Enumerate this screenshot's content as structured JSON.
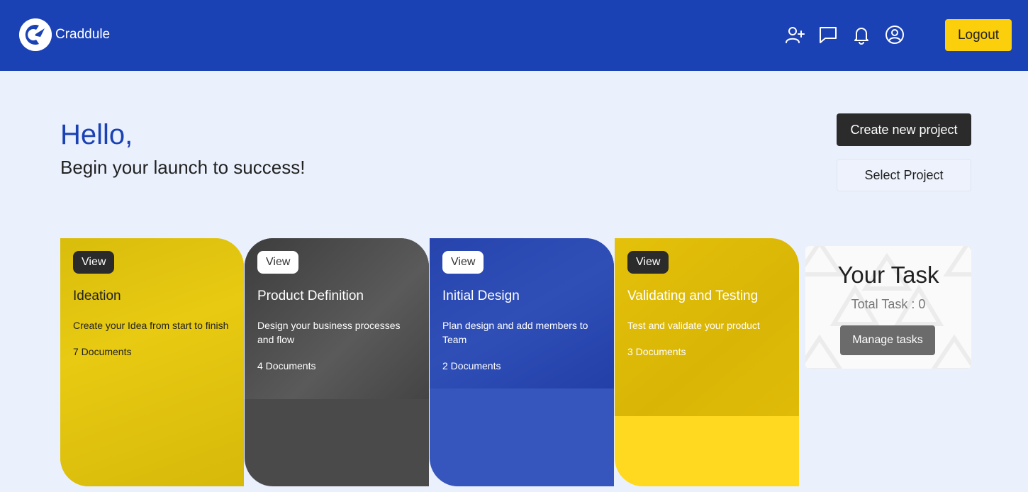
{
  "header": {
    "brand_name": "Craddule",
    "icons": [
      "add-user-icon",
      "chat-icon",
      "bell-icon",
      "user-circle-icon"
    ],
    "logout_label": "Logout",
    "colors": {
      "bar": "#1b42b4",
      "logout": "#fccf0c"
    }
  },
  "greeting": {
    "hello": "Hello,",
    "subtitle": "Begin your launch to success!"
  },
  "actions": {
    "create_label": "Create new project",
    "select_label": "Select Project"
  },
  "cards": [
    {
      "view_label": "View",
      "title": "Ideation",
      "description": "Create your Idea from start to finish",
      "documents": "7 Documents",
      "color": "#e2c40c"
    },
    {
      "view_label": "View",
      "title": "Product Definition",
      "description": "Design your business processes and flow",
      "documents": "4 Documents",
      "color": "#4a4a4a"
    },
    {
      "view_label": "View",
      "title": "Initial Design",
      "description": "Plan design and add members to Team",
      "documents": "2 Documents",
      "color": "#3656bd"
    },
    {
      "view_label": "View",
      "title": "Validating and Testing",
      "description": "Test and validate your product",
      "documents": "3 Documents",
      "color": "#ffd920"
    }
  ],
  "task_card": {
    "title": "Your Task",
    "total": "Total Task : 0",
    "button_label": "Manage tasks"
  }
}
